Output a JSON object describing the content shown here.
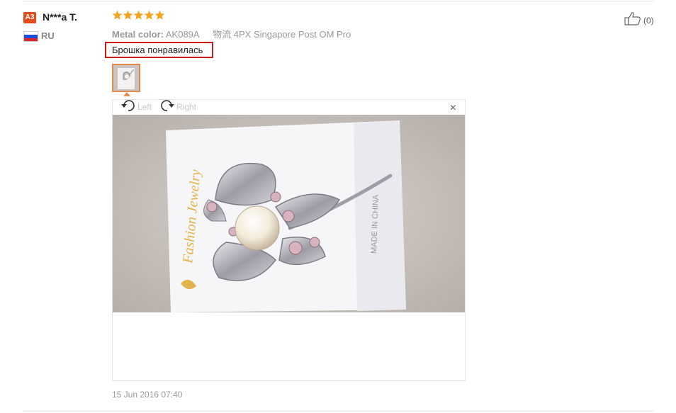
{
  "review": {
    "user": {
      "badge": "A3",
      "name": "N***a T.",
      "country": "RU",
      "flag_colors": [
        "#ffffff",
        "#1c4fd8",
        "#d8262e"
      ]
    },
    "rating": 5,
    "star_color": "#f7a21b",
    "meta": {
      "color_label": "Metal color:",
      "color_value": "AK089A",
      "shipping_label": "物流",
      "shipping_value": "4PX Singapore Post OM Pro"
    },
    "text": "Брошка понравилась",
    "viewer": {
      "rotate_left_label": "Left",
      "rotate_right_label": "Right",
      "close_glyph": "×",
      "card_text": "Fashion Jewelry",
      "card_made_in": "MADE IN CHINA"
    },
    "date": "15 Jun 2016 07:40",
    "likes": "(0)"
  },
  "icons": {
    "star": "star-icon",
    "rotate_left": "rotate-left-icon",
    "rotate_right": "rotate-right-icon",
    "close": "close-icon",
    "thumbs_up": "thumbs-up-icon"
  }
}
